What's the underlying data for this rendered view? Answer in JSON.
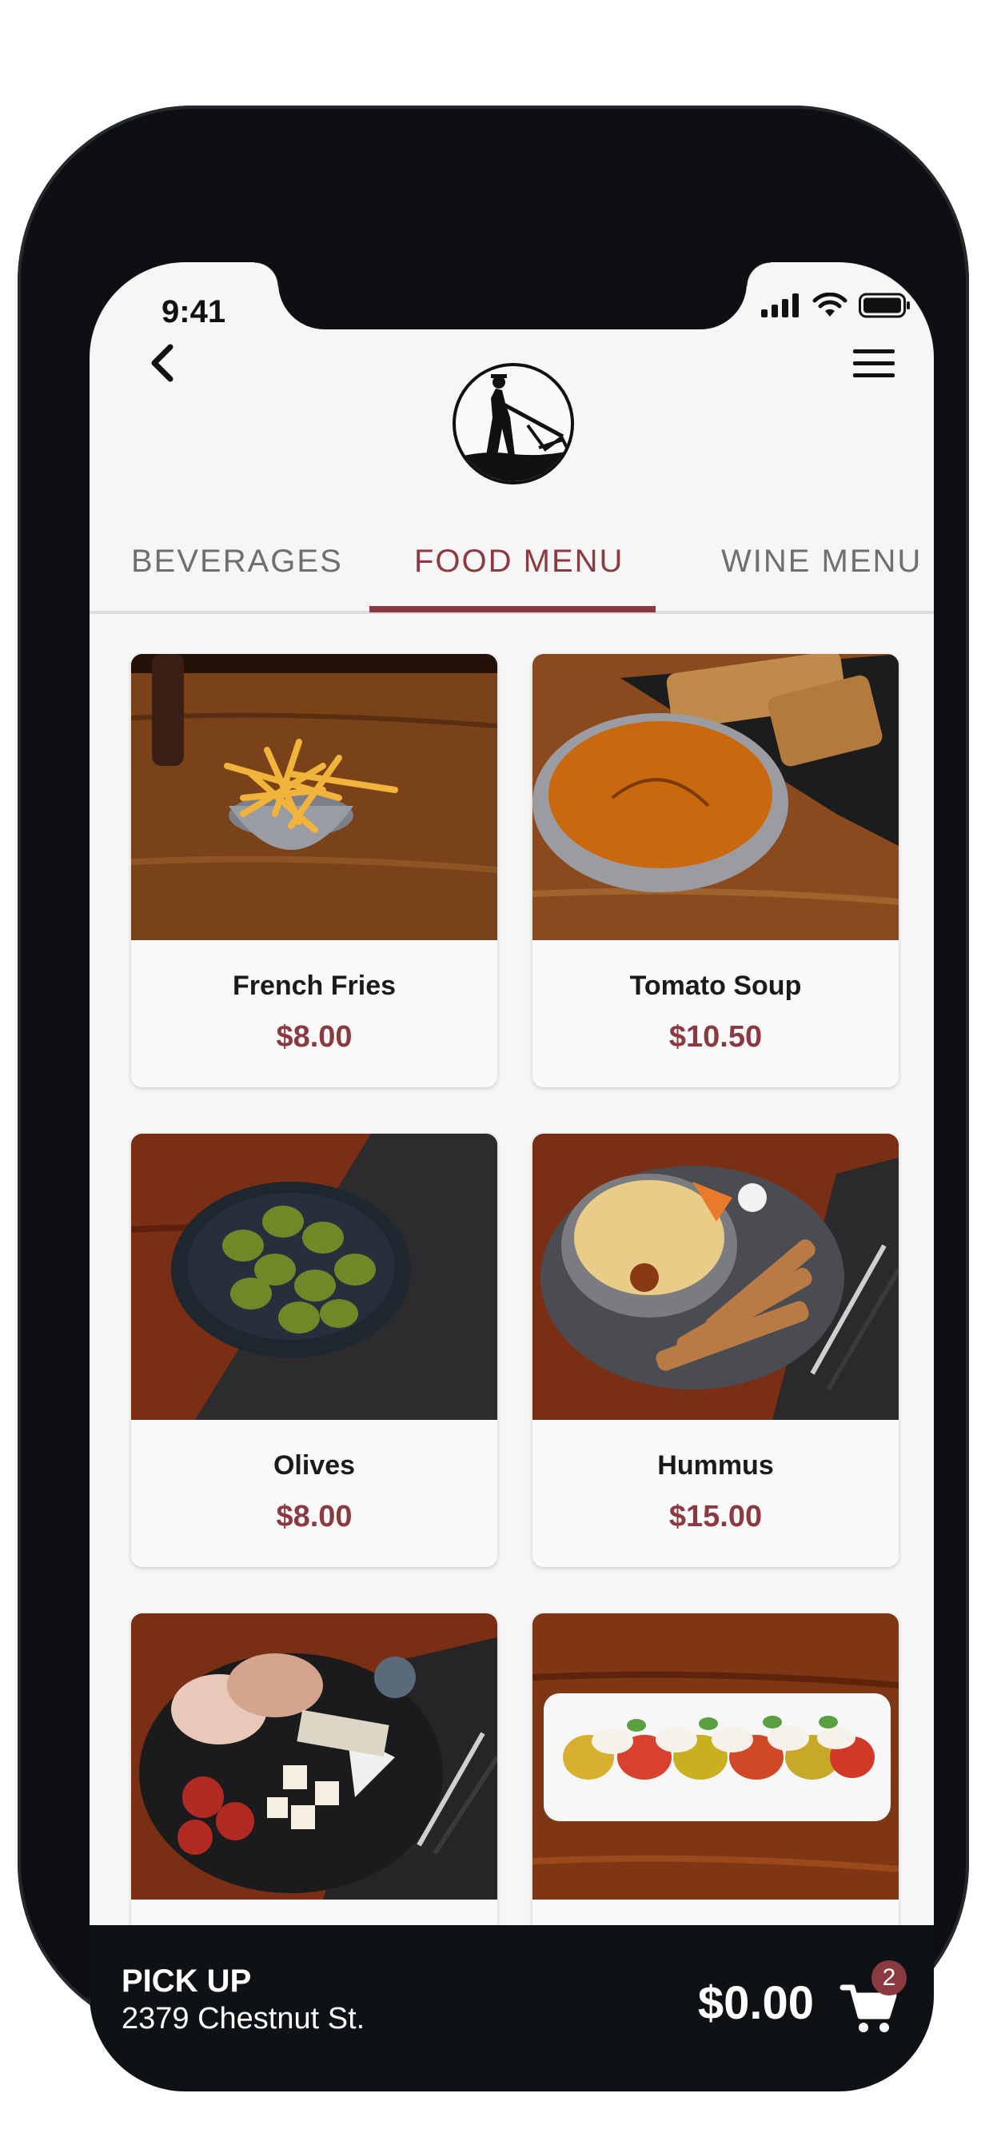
{
  "status_bar": {
    "time": "9:41"
  },
  "header": {
    "logo": "farmer-plow-logo"
  },
  "tabs": [
    {
      "label": "BEVERAGES",
      "active": false
    },
    {
      "label": "FOOD MENU",
      "active": true
    },
    {
      "label": "WINE MENU",
      "active": false
    }
  ],
  "menu_items": [
    {
      "name": "French Fries",
      "price": "$8.00"
    },
    {
      "name": "Tomato Soup",
      "price": "$10.50"
    },
    {
      "name": "Olives",
      "price": "$8.00"
    },
    {
      "name": "Hummus",
      "price": "$15.00"
    }
  ],
  "bottom_bar": {
    "pickup_label": "PICK UP",
    "address": "2379 Chestnut St.",
    "total": "$0.00",
    "cart_count": "2"
  },
  "colors": {
    "accent": "#8b3a42",
    "bar": "#0f1215",
    "screen_bg": "#f6f6f7"
  }
}
